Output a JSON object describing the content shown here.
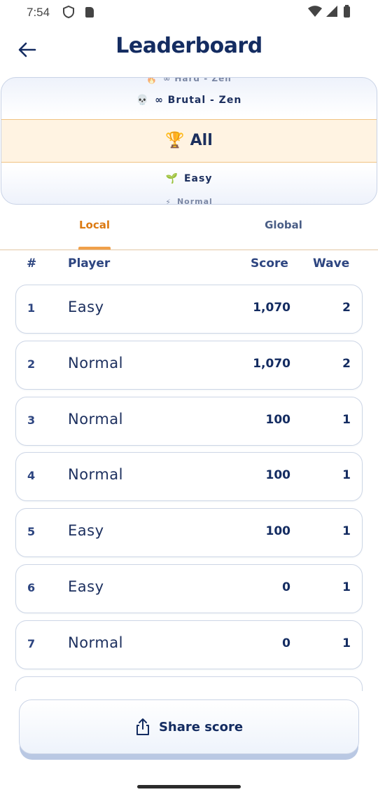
{
  "status_bar": {
    "time": "7:54"
  },
  "header": {
    "title": "Leaderboard"
  },
  "mode_picker": {
    "items": [
      {
        "emoji": "🔥",
        "label": "∞ Hard - Zen"
      },
      {
        "emoji": "💀",
        "label": "∞ Brutal - Zen"
      },
      {
        "emoji": "🏆",
        "label": "All"
      },
      {
        "emoji": "🌱",
        "label": "Easy"
      },
      {
        "emoji": "⚡",
        "label": "Normal"
      }
    ],
    "selected": "All"
  },
  "tabs": [
    {
      "label": "Local",
      "active": true
    },
    {
      "label": "Global",
      "active": false
    }
  ],
  "table": {
    "headers": {
      "rank": "#",
      "player": "Player",
      "score": "Score",
      "wave": "Wave"
    },
    "rows": [
      {
        "rank": "1",
        "player": "Easy",
        "score": "1,070",
        "wave": "2"
      },
      {
        "rank": "2",
        "player": "Normal",
        "score": "1,070",
        "wave": "2"
      },
      {
        "rank": "3",
        "player": "Normal",
        "score": "100",
        "wave": "1"
      },
      {
        "rank": "4",
        "player": "Normal",
        "score": "100",
        "wave": "1"
      },
      {
        "rank": "5",
        "player": "Easy",
        "score": "100",
        "wave": "1"
      },
      {
        "rank": "6",
        "player": "Easy",
        "score": "0",
        "wave": "1"
      },
      {
        "rank": "7",
        "player": "Normal",
        "score": "0",
        "wave": "1"
      }
    ]
  },
  "share_button": {
    "label": "Share score"
  },
  "colors": {
    "accent": "#dc7a12",
    "primary": "#142c61",
    "selected_bg": "#fff3e2"
  }
}
